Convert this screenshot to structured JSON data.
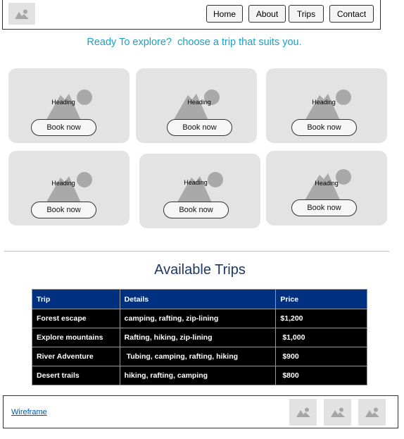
{
  "header": {
    "logo_icon": "image-placeholder-icon",
    "nav": [
      "Home",
      "About",
      "Trips",
      "Contact"
    ]
  },
  "tagline": "Ready To explore?  choose a trip that suits you.",
  "cards": [
    {
      "heading": "Heading",
      "button": "Book now"
    },
    {
      "heading": "Heading",
      "button": "Book now"
    },
    {
      "heading": "Heading",
      "button": "Book now"
    },
    {
      "heading": "Heading",
      "button": "Book now"
    },
    {
      "heading": "Heading",
      "button": "Book now"
    },
    {
      "heading": "Heading",
      "button": "Book now"
    }
  ],
  "available_trips": {
    "title": "Available Trips",
    "columns": [
      "Trip",
      "Details",
      "Price"
    ],
    "rows": [
      [
        "Forest escape",
        "camping, rafting, zip-lining",
        "$1,200"
      ],
      [
        "Explore mountains",
        "Rafting, hiking, zip-lining",
        " $1,000"
      ],
      [
        "River Adventure",
        " Tubing, camping, rafting, hiking",
        " $900"
      ],
      [
        "Desert trails",
        "hiking, rafting, camping",
        " $800"
      ]
    ]
  },
  "footer": {
    "link": "Wireframe",
    "icons": [
      "image-placeholder-icon",
      "image-placeholder-icon",
      "image-placeholder-icon"
    ]
  },
  "colors": {
    "accent_text": "#1ba1c4",
    "title_text": "#1f3764",
    "table_header": "#003080",
    "table_body": "#000000",
    "card_bg": "#e3e3e3"
  }
}
